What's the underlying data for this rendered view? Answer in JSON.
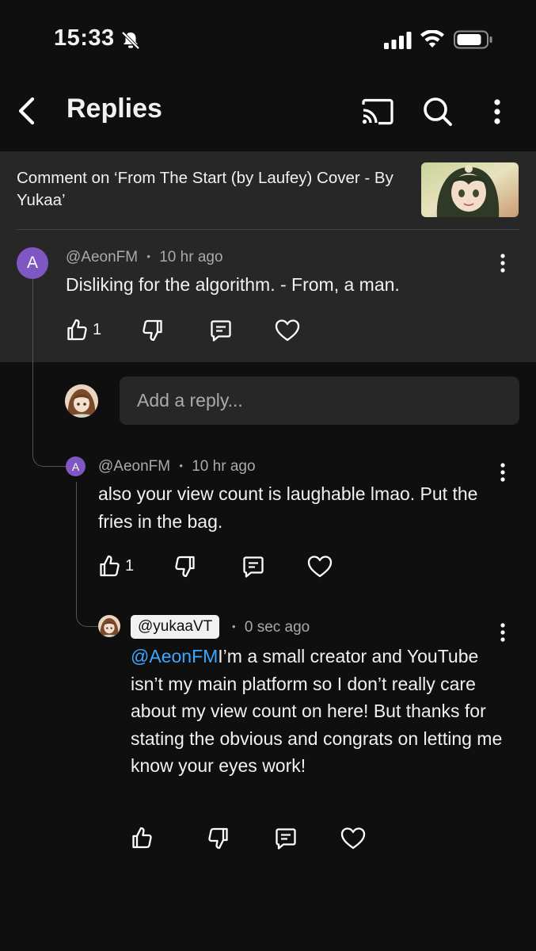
{
  "status_bar": {
    "time": "15:33"
  },
  "app_bar": {
    "title": "Replies"
  },
  "context": {
    "text": "Comment on ‘From The Start (by Laufey) Cover - By Yukaa’"
  },
  "parent_comment": {
    "author": "@AeonFM",
    "avatar_letter": "A",
    "separator": "•",
    "time": "10 hr ago",
    "text": "Disliking for the algorithm. - From, a man.",
    "likes": "1"
  },
  "reply_box": {
    "placeholder": "Add a reply..."
  },
  "reply_1": {
    "author": "@AeonFM",
    "avatar_letter": "A",
    "separator": "•",
    "time": "10 hr ago",
    "text": "also your view count is laughable lmao. Put the fries in the bag.",
    "likes": "1"
  },
  "reply_2": {
    "author": "@yukaaVT",
    "separator": "•",
    "time": "0 sec ago",
    "mention": "@AeonFM",
    "text": "I’m a small creator and YouTube isn’t my main platform so I don’t really care about my view count on here! But thanks for stating the obvious and congrats on letting me know your eyes work!"
  },
  "colors": {
    "background": "#0f0f0f",
    "surface": "#272727",
    "avatar": "#7e57c2",
    "mention": "#3ea6ff"
  },
  "icons": [
    "bell-slash-icon",
    "signal-icon",
    "wifi-icon",
    "battery-icon",
    "back-icon",
    "cast-icon",
    "search-icon",
    "more-icon",
    "like-icon",
    "dislike-icon",
    "reply-icon",
    "heart-icon"
  ]
}
